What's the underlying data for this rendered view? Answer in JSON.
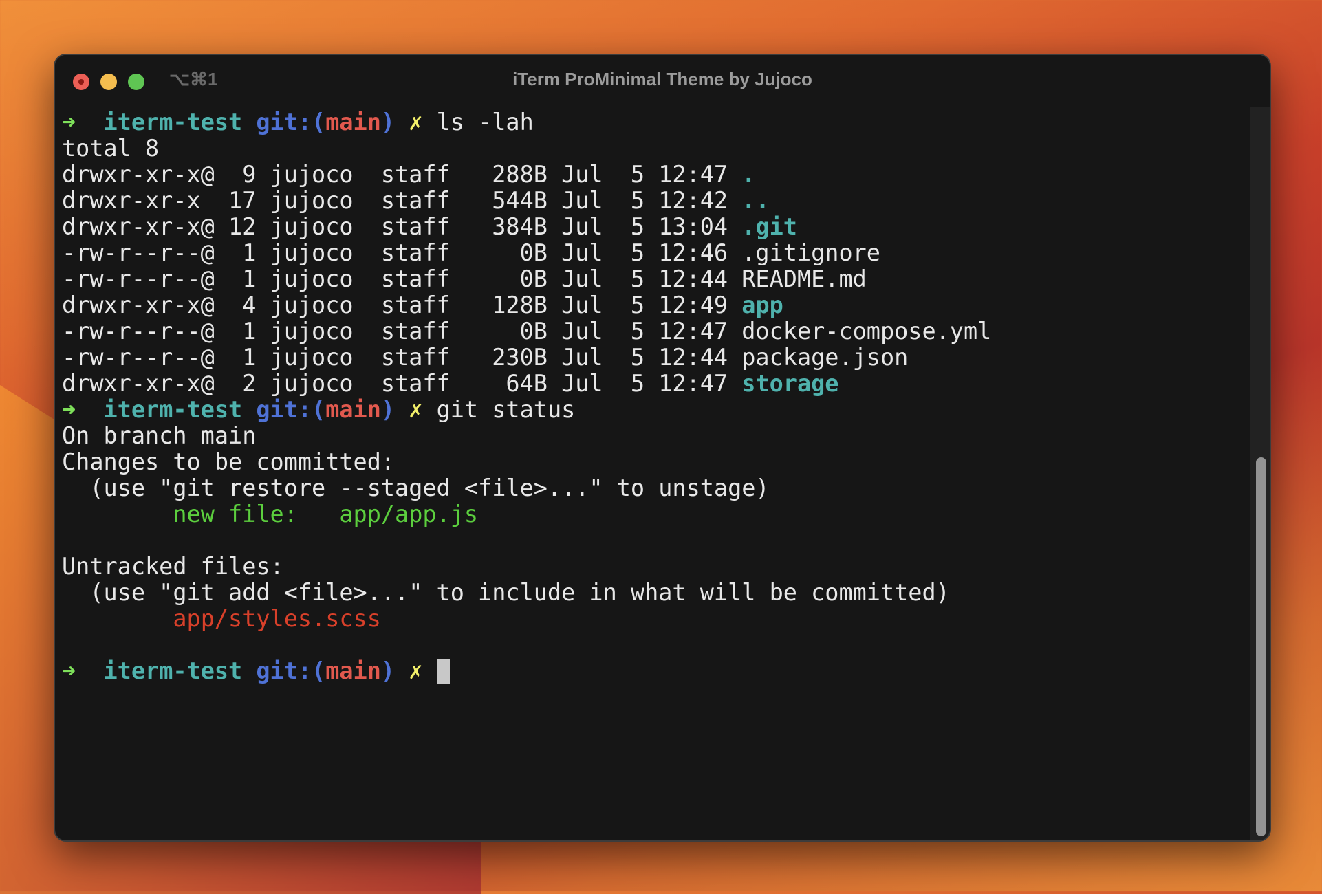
{
  "window": {
    "shortcut": "⌥⌘1",
    "title": "iTerm ProMinimal Theme by Jujoco"
  },
  "scrollbar": {
    "thumb_start": 0.48,
    "thumb_size": 0.52
  },
  "colors": {
    "background": "#161616",
    "prompt_arrow": "#7ee05a",
    "directory": "#4fb2ad",
    "git": "#4f72d6",
    "branch": "#e2594e",
    "dirty": "#f3f06a",
    "staged": "#5ccf3e",
    "untracked": "#d8402a"
  },
  "lines": [
    [
      {
        "t": "➜  ",
        "c": "arrow"
      },
      {
        "t": "iterm-test",
        "c": "dir"
      },
      {
        "t": " ",
        "c": "w"
      },
      {
        "t": "git:(",
        "c": "git"
      },
      {
        "t": "main",
        "c": "branch"
      },
      {
        "t": ")",
        "c": "git"
      },
      {
        "t": " ✗",
        "c": "dirty"
      },
      {
        "t": " ls -lah",
        "c": "w"
      }
    ],
    [
      {
        "t": "total 8",
        "c": "w"
      }
    ],
    [
      {
        "t": "drwxr-xr-x@  9 jujoco  staff   288B Jul  5 12:47 ",
        "c": "w"
      },
      {
        "t": ".",
        "c": "dir"
      }
    ],
    [
      {
        "t": "drwxr-xr-x  17 jujoco  staff   544B Jul  5 12:42 ",
        "c": "w"
      },
      {
        "t": "..",
        "c": "dir"
      }
    ],
    [
      {
        "t": "drwxr-xr-x@ 12 jujoco  staff   384B Jul  5 13:04 ",
        "c": "w"
      },
      {
        "t": ".git",
        "c": "dir"
      }
    ],
    [
      {
        "t": "-rw-r--r--@  1 jujoco  staff     0B Jul  5 12:46 .gitignore",
        "c": "w"
      }
    ],
    [
      {
        "t": "-rw-r--r--@  1 jujoco  staff     0B Jul  5 12:44 README.md",
        "c": "w"
      }
    ],
    [
      {
        "t": "drwxr-xr-x@  4 jujoco  staff   128B Jul  5 12:49 ",
        "c": "w"
      },
      {
        "t": "app",
        "c": "dir"
      }
    ],
    [
      {
        "t": "-rw-r--r--@  1 jujoco  staff     0B Jul  5 12:47 docker-compose.yml",
        "c": "w"
      }
    ],
    [
      {
        "t": "-rw-r--r--@  1 jujoco  staff   230B Jul  5 12:44 package.json",
        "c": "w"
      }
    ],
    [
      {
        "t": "drwxr-xr-x@  2 jujoco  staff    64B Jul  5 12:47 ",
        "c": "w"
      },
      {
        "t": "storage",
        "c": "dir"
      }
    ],
    [
      {
        "t": "➜  ",
        "c": "arrow"
      },
      {
        "t": "iterm-test",
        "c": "dir"
      },
      {
        "t": " ",
        "c": "w"
      },
      {
        "t": "git:(",
        "c": "git"
      },
      {
        "t": "main",
        "c": "branch"
      },
      {
        "t": ")",
        "c": "git"
      },
      {
        "t": " ✗",
        "c": "dirty"
      },
      {
        "t": " git status",
        "c": "w"
      }
    ],
    [
      {
        "t": "On branch main",
        "c": "w"
      }
    ],
    [
      {
        "t": "Changes to be committed:",
        "c": "w"
      }
    ],
    [
      {
        "t": "  (use \"git restore --staged <file>...\" to unstage)",
        "c": "w"
      }
    ],
    [
      {
        "t": "        ",
        "c": "w"
      },
      {
        "t": "new file:   app/app.js",
        "c": "staged"
      }
    ],
    [],
    [
      {
        "t": "Untracked files:",
        "c": "w"
      }
    ],
    [
      {
        "t": "  (use \"git add <file>...\" to include in what will be committed)",
        "c": "w"
      }
    ],
    [
      {
        "t": "        ",
        "c": "w"
      },
      {
        "t": "app/styles.scss",
        "c": "untracked"
      }
    ],
    [],
    [
      {
        "t": "➜  ",
        "c": "arrow"
      },
      {
        "t": "iterm-test",
        "c": "dir"
      },
      {
        "t": " ",
        "c": "w"
      },
      {
        "t": "git:(",
        "c": "git"
      },
      {
        "t": "main",
        "c": "branch"
      },
      {
        "t": ")",
        "c": "git"
      },
      {
        "t": " ✗ ",
        "c": "dirty"
      }
    ]
  ]
}
